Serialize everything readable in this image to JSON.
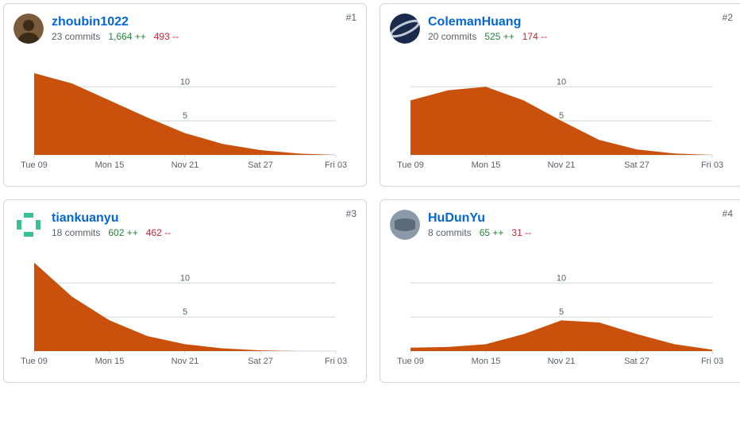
{
  "chart_data": [
    {
      "type": "area",
      "ymax": 14,
      "y_ticks": [
        5,
        10
      ],
      "x_ticks": [
        "Tue 09",
        "Mon 15",
        "Nov 21",
        "Sat 27",
        "Fri 03"
      ],
      "values": [
        12,
        10.5,
        8,
        5.5,
        3.2,
        1.6,
        0.7,
        0.2,
        0
      ]
    },
    {
      "type": "area",
      "ymax": 14,
      "y_ticks": [
        5,
        10
      ],
      "x_ticks": [
        "Tue 09",
        "Mon 15",
        "Nov 21",
        "Sat 27",
        "Fri 03"
      ],
      "values": [
        8,
        9.5,
        10,
        8,
        5,
        2.2,
        0.8,
        0.2,
        0
      ]
    },
    {
      "type": "area",
      "ymax": 14,
      "y_ticks": [
        5,
        10
      ],
      "x_ticks": [
        "Tue 09",
        "Mon 15",
        "Nov 21",
        "Sat 27",
        "Fri 03"
      ],
      "values": [
        13,
        8,
        4.5,
        2.2,
        1,
        0.4,
        0.1,
        0,
        0
      ]
    },
    {
      "type": "area",
      "ymax": 14,
      "y_ticks": [
        5,
        10
      ],
      "x_ticks": [
        "Tue 09",
        "Mon 15",
        "Nov 21",
        "Sat 27",
        "Fri 03"
      ],
      "values": [
        0.5,
        0.6,
        1,
        2.5,
        4.5,
        4.2,
        2.5,
        1,
        0.2
      ]
    }
  ],
  "cards": [
    {
      "rank": "#1",
      "name": "zhoubin1022",
      "commits": "23 commits",
      "additions": "1,664 ++",
      "deletions": "493 --",
      "avatar_bg": "#7a5c3b",
      "avatar_fg": "#3a2a18"
    },
    {
      "rank": "#2",
      "name": "ColemanHuang",
      "commits": "20 commits",
      "additions": "525 ++",
      "deletions": "174 --",
      "avatar_bg": "#1a2a4a",
      "avatar_fg": "#c0c8d8"
    },
    {
      "rank": "#3",
      "name": "tiankuanyu",
      "commits": "18 commits",
      "additions": "602 ++",
      "deletions": "462 --",
      "avatar_bg": "#ffffff",
      "avatar_fg": "#3ac192"
    },
    {
      "rank": "#4",
      "name": "HuDunYu",
      "commits": "8 commits",
      "additions": "65 ++",
      "deletions": "31 --",
      "avatar_bg": "#8a9aa8",
      "avatar_fg": "#5a6a78"
    }
  ]
}
